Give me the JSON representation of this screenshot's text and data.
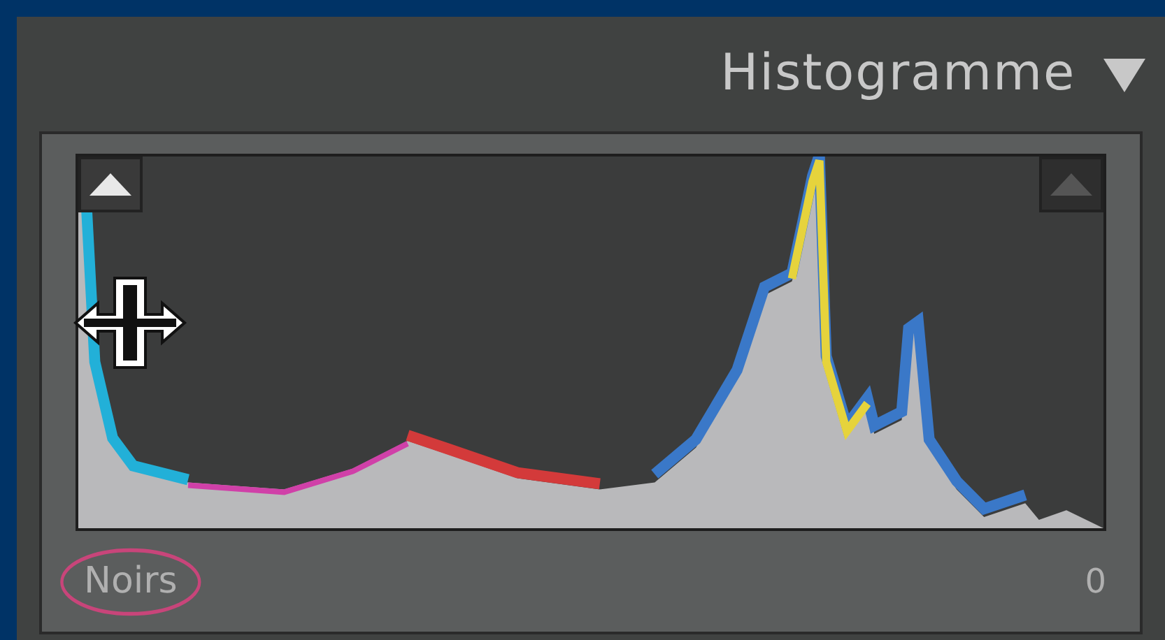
{
  "panel": {
    "title": "Histogramme",
    "expanded": true
  },
  "histogram": {
    "shadow_clipping": true,
    "highlight_clipping": false
  },
  "readout": {
    "label": "Noirs",
    "value": "0"
  }
}
